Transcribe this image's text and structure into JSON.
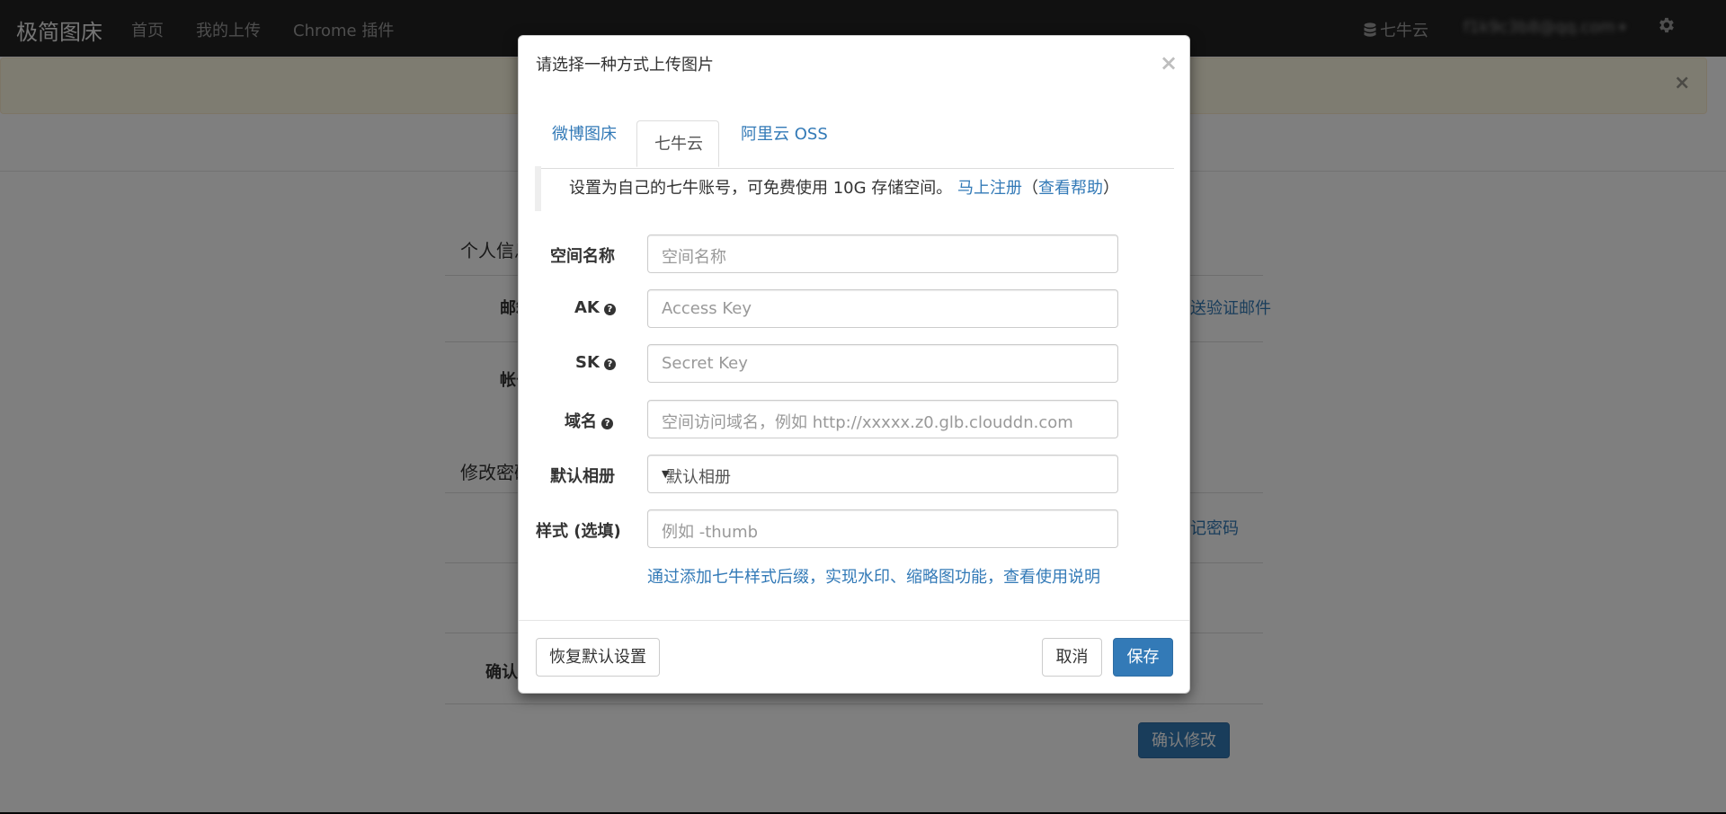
{
  "navbar": {
    "brand": "极简图床",
    "links": [
      "首页",
      "我的上传",
      "Chrome 插件"
    ],
    "storage": "七牛云",
    "user_email": "f1k9c3b8@qq.com"
  },
  "page": {
    "section_profile": "个人信息",
    "row_email_label": "邮箱",
    "row_email_link": "发送验证邮件",
    "row_account_label": "帐号",
    "section_password": "修改密码",
    "row_password_link": "忘记密码",
    "row_confirm_label": "确认密码",
    "confirm_button": "确认修改"
  },
  "modal": {
    "title": "请选择一种方式上传图片",
    "tabs": [
      "微博图床",
      "七牛云",
      "阿里云 OSS"
    ],
    "active_tab": "七牛云",
    "note": {
      "text": "设置为自己的七牛账号，可免费使用 10G 存储空间。",
      "register_link": "马上注册",
      "paren_open": "（",
      "help_link": "查看帮助",
      "paren_close": "）"
    },
    "fields": {
      "bucket": {
        "label": "空间名称",
        "placeholder": "空间名称"
      },
      "ak": {
        "label": "AK",
        "placeholder": "Access Key"
      },
      "sk": {
        "label": "SK",
        "placeholder": "Secret Key"
      },
      "domain": {
        "label": "域名",
        "placeholder": "空间访问域名，例如 http://xxxxx.z0.glb.clouddn.com"
      },
      "album": {
        "label": "默认相册",
        "value": "默认相册"
      },
      "style": {
        "label": "样式 (选填)",
        "placeholder": "例如 -thumb"
      }
    },
    "style_help": "通过添加七牛样式后缀，实现水印、缩略图功能，查看使用说明",
    "buttons": {
      "reset": "恢复默认设置",
      "cancel": "取消",
      "save": "保存"
    }
  },
  "colors": {
    "navbar_bg": "#222222",
    "link": "#337ab7",
    "primary": "#337ab7",
    "alert_bg": "#fcf8e3"
  },
  "icons": [
    "database-icon",
    "gear-icon",
    "close-icon",
    "question-circle-icon",
    "chevron-down-icon",
    "caret-down-icon"
  ]
}
